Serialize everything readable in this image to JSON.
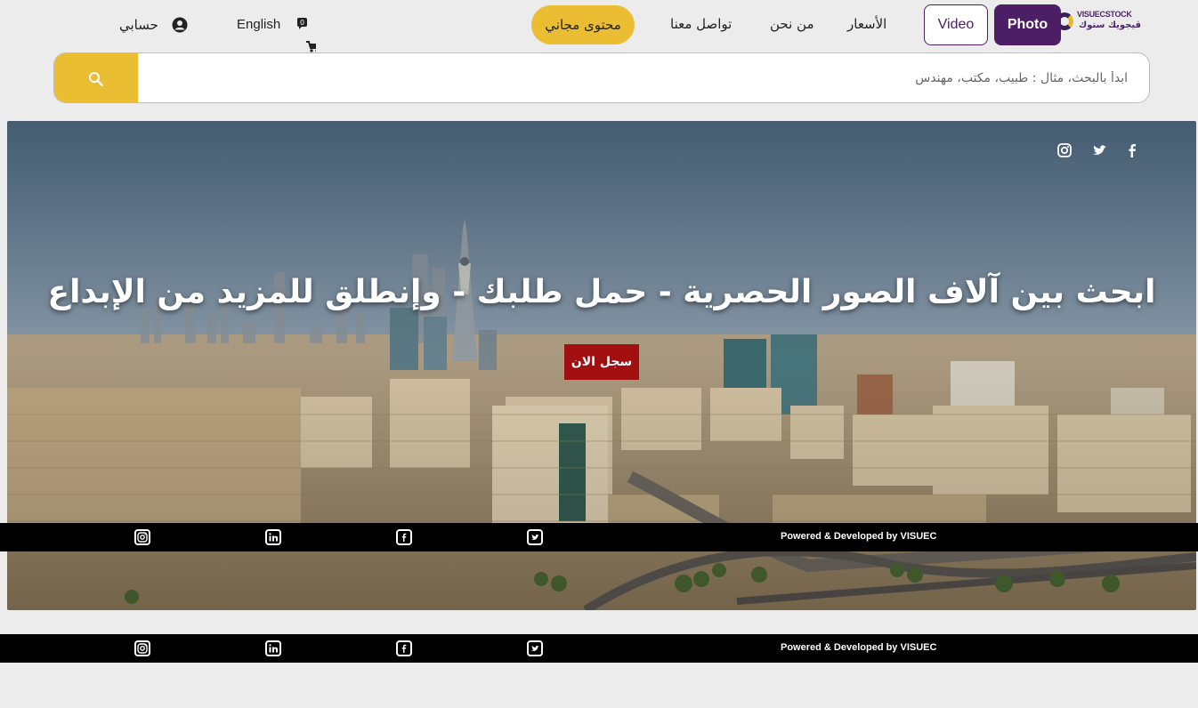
{
  "header": {
    "logo": {
      "text_en": "VISUECSTOCK",
      "text_ar": "ڤيجويك ستوك"
    },
    "photo_label": "Photo",
    "video_label": "Video",
    "nav": {
      "prices": "الأسعار",
      "about": "من نحن",
      "contact": "تواصل معنا"
    },
    "free_content": "محتوى مجاني",
    "cart_count": "0",
    "language": "English",
    "account": "حسابي"
  },
  "search": {
    "placeholder": "ابدأ بالبحث، مثال : طبيب، مكتب، مهندس"
  },
  "hero": {
    "title": "ابحث بين آلاف الصور الحصرية - حمل طلبك - وإنطلق للمزيد من الإبداع",
    "cta": "سجل الان",
    "social_icons": [
      "instagram-icon",
      "twitter-icon",
      "facebook-icon"
    ]
  },
  "footer": {
    "powered": "Powered & Developed by VISUEC",
    "social_icons": [
      "instagram-icon",
      "linkedin-icon",
      "facebook-icon",
      "twitter-icon"
    ]
  },
  "colors": {
    "brand_purple": "#4b1e66",
    "accent_yellow": "#eabd32",
    "cta_red": "#a20f0f"
  }
}
